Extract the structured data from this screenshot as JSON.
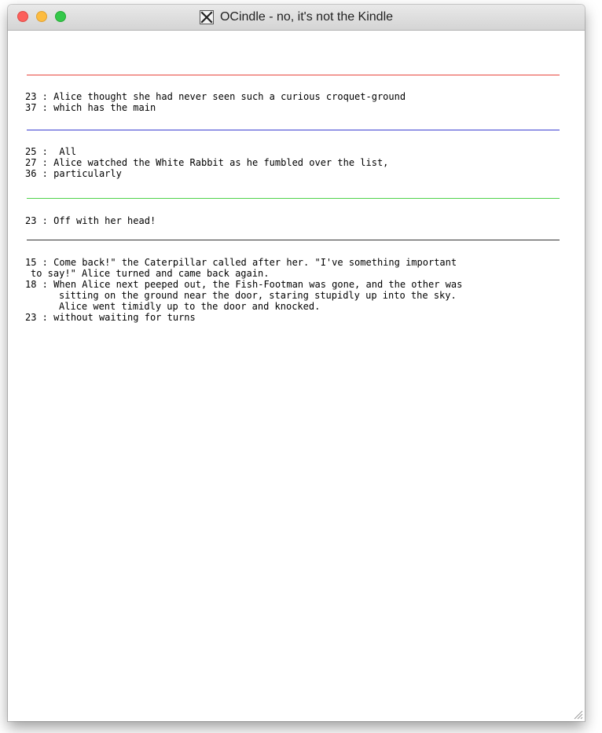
{
  "window": {
    "title": "OCindle - no, it's not the Kindle"
  },
  "colors": {
    "separator_1": "#e8463e",
    "separator_2": "#3b3fd0",
    "separator_3": "#4fd34a",
    "separator_4": "#333333"
  },
  "groups": [
    {
      "entries": [
        {
          "number": "23",
          "text": "Alice thought she had never seen such a curious croquet-ground"
        },
        {
          "number": "37",
          "text": "which has the main"
        }
      ]
    },
    {
      "entries": [
        {
          "number": "25",
          "text": " All"
        },
        {
          "number": "27",
          "text": "Alice watched the White Rabbit as he fumbled over the list,"
        },
        {
          "number": "36",
          "text": "particularly"
        }
      ]
    },
    {
      "entries": [
        {
          "number": "23",
          "text": "Off with her head!"
        }
      ]
    },
    {
      "entries": [
        {
          "number": "15",
          "text": "Come back!\" the Caterpillar called after her. \"I've something important",
          "continuation": [
            "to say!\" Alice turned and came back again."
          ]
        },
        {
          "number": "18",
          "text": "When Alice next peeped out, the Fish-Footman was gone, and the other was",
          "continuation": [
            "sitting on the ground near the door, staring stupidly up into the sky.",
            "Alice went timidly up to the door and knocked."
          ]
        },
        {
          "number": "23",
          "text": "without waiting for turns"
        }
      ]
    }
  ],
  "icons": {
    "app": "x11-icon",
    "resize": "resize-grip-icon"
  }
}
